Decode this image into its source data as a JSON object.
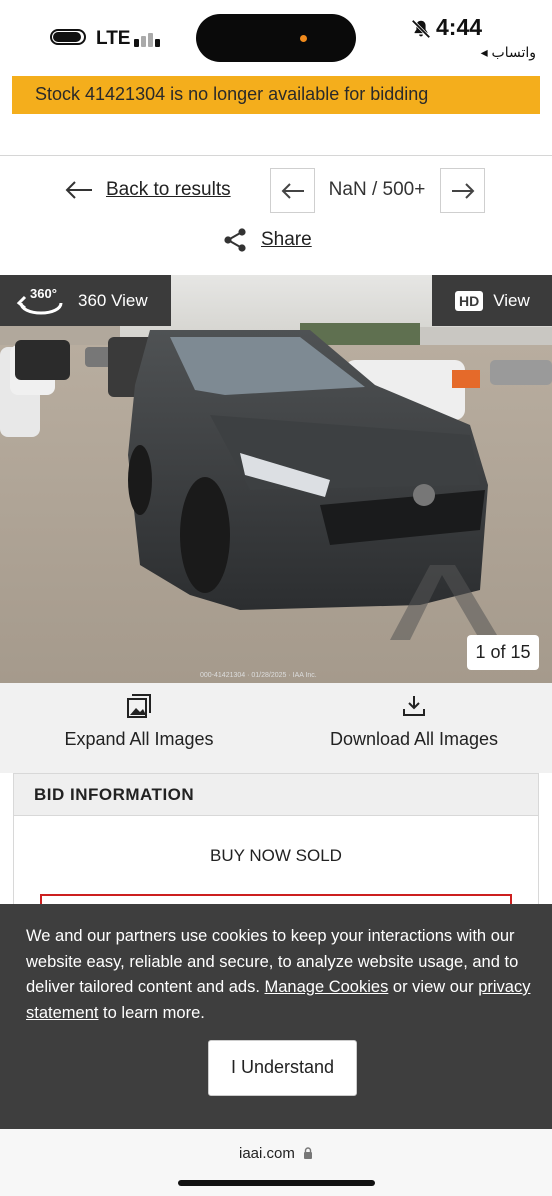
{
  "status_bar": {
    "network": "LTE",
    "time": "4:44",
    "back_app": "◂ واتساب"
  },
  "banner": {
    "message": "Stock 41421304 is no longer available for bidding",
    "color": "#f4ae1c"
  },
  "nav": {
    "back_label": "Back to results",
    "pager_text": "NaN / 500+",
    "share_label": "Share"
  },
  "gallery": {
    "view360_badge": "360°",
    "view360_label": "360 View",
    "hd_badge": "HD",
    "hd_label": "View",
    "counter": "1 of 15",
    "caption": "000-41421304 · 01/28/2025 · IAA Inc."
  },
  "image_actions": {
    "expand_label": "Expand All Images",
    "download_label": "Download All Images"
  },
  "bid": {
    "header": "BID INFORMATION",
    "status": "BUY NOW SOLD",
    "alert_color": "#cc1f1f"
  },
  "cookie": {
    "text_before": "We and our partners use cookies to keep your interactions with our website easy, reliable and secure, to analyze website usage, and to deliver tailored content and ads. ",
    "manage_link": "Manage Cookies",
    "text_middle": " or view our ",
    "privacy_link": "privacy statement",
    "text_after": " to learn more.",
    "button_label": "I Understand"
  },
  "browser": {
    "url": "iaai.com"
  }
}
